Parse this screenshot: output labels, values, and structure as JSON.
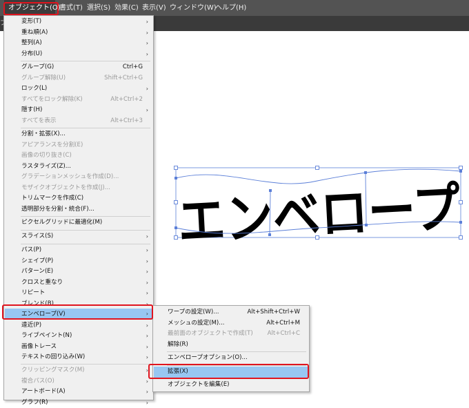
{
  "menubar": {
    "items": [
      {
        "label": "オブジェクト(O)",
        "active": true
      },
      {
        "label": "書式(T)"
      },
      {
        "label": "選択(S)"
      },
      {
        "label": "効果(C)"
      },
      {
        "label": "表示(V)"
      },
      {
        "label": "ウィンドウ(W)"
      },
      {
        "label": "ヘルプ(H)"
      }
    ]
  },
  "docbar": {
    "stub": "プ"
  },
  "object_menu": {
    "items": [
      {
        "label": "変形(T)",
        "submenu": true
      },
      {
        "label": "重ね順(A)",
        "submenu": true
      },
      {
        "label": "整列(A)",
        "submenu": true
      },
      {
        "label": "分布(U)",
        "submenu": true
      },
      {
        "label": "グループ(G)",
        "shortcut": "Ctrl+G"
      },
      {
        "label": "グループ解除(U)",
        "shortcut": "Shift+Ctrl+G",
        "disabled": true
      },
      {
        "label": "ロック(L)",
        "submenu": true
      },
      {
        "label": "すべてをロック解除(K)",
        "shortcut": "Alt+Ctrl+2",
        "disabled": true
      },
      {
        "label": "隠す(H)",
        "submenu": true
      },
      {
        "label": "すべてを表示",
        "shortcut": "Alt+Ctrl+3",
        "disabled": true
      },
      {
        "label": "分割・拡張(X)..."
      },
      {
        "label": "アピアランスを分割(E)",
        "disabled": true
      },
      {
        "label": "画像の切り抜き(C)",
        "disabled": true
      },
      {
        "label": "ラスタライズ(Z)..."
      },
      {
        "label": "グラデーションメッシュを作成(D)...",
        "disabled": true
      },
      {
        "label": "モザイクオブジェクトを作成(J)...",
        "disabled": true
      },
      {
        "label": "トリムマークを作成(C)"
      },
      {
        "label": "透明部分を分割・統合(F)..."
      },
      {
        "label": "ピクセルグリッドに最適化(M)"
      },
      {
        "label": "スライス(S)",
        "submenu": true
      },
      {
        "label": "パス(P)",
        "submenu": true
      },
      {
        "label": "シェイプ(P)",
        "submenu": true
      },
      {
        "label": "パターン(E)",
        "submenu": true
      },
      {
        "label": "クロスと重なり",
        "submenu": true
      },
      {
        "label": "リピート",
        "submenu": true
      },
      {
        "label": "ブレンド(B)",
        "submenu": true
      },
      {
        "label": "エンベロープ(V)",
        "submenu": true,
        "selected": true
      },
      {
        "label": "遠近(P)",
        "submenu": true
      },
      {
        "label": "ライブペイント(N)",
        "submenu": true
      },
      {
        "label": "画像トレース",
        "submenu": true
      },
      {
        "label": "テキストの回り込み(W)",
        "submenu": true
      },
      {
        "label": "クリッピングマスク(M)",
        "submenu": true,
        "disabled": true
      },
      {
        "label": "複合パス(O)",
        "submenu": true,
        "disabled": true
      },
      {
        "label": "アートボード(A)",
        "submenu": true
      },
      {
        "label": "グラフ(R)",
        "submenu": true
      }
    ]
  },
  "envelope_submenu": {
    "items": [
      {
        "label": "ワープの設定(W)...",
        "shortcut": "Alt+Shift+Ctrl+W"
      },
      {
        "label": "メッシュの設定(M)...",
        "shortcut": "Alt+Ctrl+M"
      },
      {
        "label": "最前面のオブジェクトで作成(T)",
        "shortcut": "Alt+Ctrl+C",
        "disabled": true
      },
      {
        "label": "解除(R)"
      },
      {
        "label": "エンベロープオプション(O)..."
      },
      {
        "label": "拡張(X)",
        "selected": true
      },
      {
        "label": "オブジェクトを編集(E)"
      }
    ]
  },
  "artwork": {
    "text": "エンベロープ",
    "stroke_color": "#5b7fd8",
    "fill_color": "#000000"
  },
  "colors": {
    "highlight": "#e0141e",
    "selection": "#98c7f2",
    "menubar": "#535353"
  }
}
